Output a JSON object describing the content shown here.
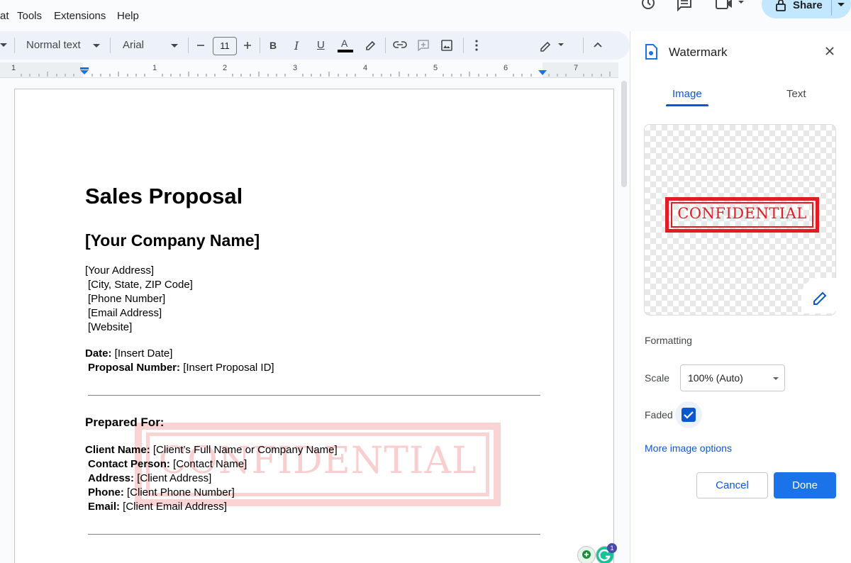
{
  "menu": {
    "items": [
      "at",
      "Tools",
      "Extensions",
      "Help"
    ]
  },
  "header": {
    "share_label": "Share"
  },
  "toolbar": {
    "style_label": "Normal text",
    "font_label": "Arial",
    "font_size": "11",
    "bold_label": "B",
    "italic_label": "I",
    "underline_label": "U",
    "text_color_label": "A"
  },
  "ruler": {
    "numbers": [
      "1",
      "1",
      "2",
      "3",
      "4",
      "5",
      "6",
      "7"
    ]
  },
  "document": {
    "title": "Sales Proposal",
    "company": "[Your Company Name]",
    "address_lines": [
      "[Your Address]",
      "[City, State, ZIP Code]",
      "[Phone Number]",
      "[Email Address]",
      "[Website]"
    ],
    "date_label": "Date:",
    "date_value": " [Insert Date]",
    "proposal_label": "Proposal Number:",
    "proposal_value": " [Insert Proposal ID]",
    "prepared_for": "Prepared For:",
    "client": [
      {
        "label": "Client Name:",
        "value": " [Client’s Full Name or Company Name]"
      },
      {
        "label": "Contact Person:",
        "value": " [Contact Name]"
      },
      {
        "label": "Address:",
        "value": " [Client Address]"
      },
      {
        "label": "Phone:",
        "value": " [Client Phone Number]"
      },
      {
        "label": "Email:",
        "value": " [Client Email Address]"
      }
    ],
    "watermark_text": "CONFIDENTIAL"
  },
  "badge": {
    "count": "1"
  },
  "panel": {
    "title": "Watermark",
    "tabs": [
      "Image",
      "Text"
    ],
    "stamp_text": "CONFIDENTIAL",
    "formatting_label": "Formatting",
    "scale_label": "Scale",
    "scale_value": "100% (Auto)",
    "faded_label": "Faded",
    "faded_checked": true,
    "more_options": "More image options",
    "cancel_label": "Cancel",
    "done_label": "Done"
  },
  "colors": {
    "accent": "#0b57d0",
    "primary_button": "#1a73e8",
    "share_bg": "#c2e7ff",
    "toolbar_bg": "#edf2fa",
    "stamp_red": "#e31b23"
  }
}
